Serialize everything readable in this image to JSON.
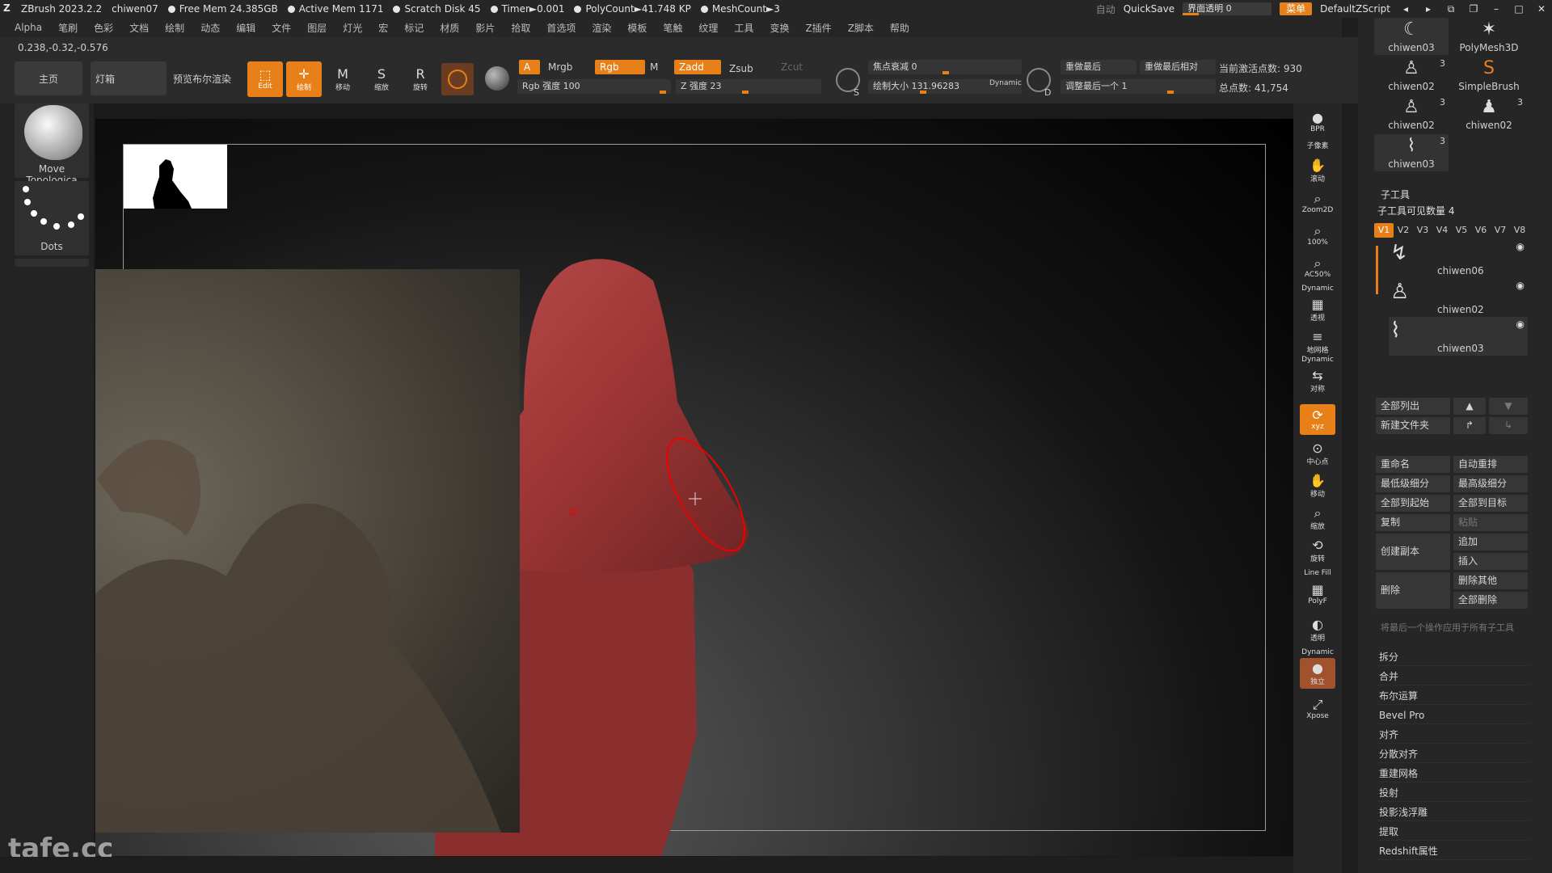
{
  "title_bar": {
    "app": "ZBrush 2023.2.2",
    "project": "chiwen07",
    "free_mem": "Free Mem 24.385GB",
    "active_mem": "Active Mem 1171",
    "scratch_disk": "Scratch Disk 45",
    "timer": "Timer►0.001",
    "poly_count": "PolyCount►41.748 KP",
    "mesh_count": "MeshCount►3",
    "auto": "自动",
    "quicksave": "QuickSave",
    "transparency": "界面透明 0",
    "menu": "菜单",
    "script": "DefaultZScript"
  },
  "menu_items": [
    "Alpha",
    "笔刷",
    "色彩",
    "文档",
    "绘制",
    "动态",
    "编辑",
    "文件",
    "图层",
    "灯光",
    "宏",
    "标记",
    "材质",
    "影片",
    "拾取",
    "首选项",
    "渲染",
    "模板",
    "笔触",
    "纹理",
    "工具",
    "变换",
    "Z插件",
    "Z脚本",
    "帮助"
  ],
  "coords": "0.238,-0.32,-0.576",
  "toolbar": {
    "home": "主页",
    "lightbox": "灯箱",
    "preview_bool": "预览布尔渲染",
    "edit": "Edit",
    "draw": "绘制",
    "move": "移动",
    "scale": "缩放",
    "rotate": "旋转",
    "a": "A",
    "mrgb": "Mrgb",
    "rgb": "Rgb",
    "m": "M",
    "zadd": "Zadd",
    "zsub": "Zsub",
    "zcut": "Zcut",
    "rgb_intensity": "Rgb 强度 100",
    "z_intensity": "Z 强度 23",
    "focal_shift": "焦点衰减 0",
    "draw_size": "绘制大小 131.96283",
    "dynamic": "Dynamic",
    "s_label": "S",
    "d_label": "D",
    "redo_last": "重做最后",
    "redo_last_rel": "重做最后相对",
    "adjust_last": "调整最后一个 1",
    "active_points": "当前激活点数: 930",
    "total_points": "总点数: 41,754"
  },
  "left_shelf": {
    "brush_name": "Move Topologica",
    "stroke_name": "Dots"
  },
  "right_bar": [
    "BPR",
    "子像素",
    "滚动",
    "Zoom2D",
    "100%",
    "AC50%",
    "Dynamic",
    "透视",
    "地网格",
    "Dynamic",
    "对称",
    "xyz",
    "中心点",
    "移动",
    "缩放",
    "旋转",
    "Line Fill",
    "PolyF",
    "透明",
    "Dynamic",
    "独立",
    "Xpose"
  ],
  "tool_thumbs": [
    {
      "name": "chiwen03",
      "count": ""
    },
    {
      "name": "PolyMesh3D",
      "count": ""
    },
    {
      "name": "chiwen02",
      "count": "3"
    },
    {
      "name": "SimpleBrush",
      "count": ""
    },
    {
      "name": "chiwen02",
      "count": "3"
    },
    {
      "name": "chiwen02",
      "count": "3"
    },
    {
      "name": "chiwen03",
      "count": "3"
    }
  ],
  "subtool_panel": {
    "title": "子工具",
    "visible_count": "子工具可见数量 4",
    "versions": [
      "V1",
      "V2",
      "V3",
      "V4",
      "V5",
      "V6",
      "V7",
      "V8"
    ],
    "subtools": [
      "chiwen06",
      "chiwen02",
      "chiwen03"
    ],
    "list_all": "全部列出",
    "new_folder": "新建文件夹",
    "rename": "重命名",
    "auto_reorder": "自动重排",
    "lowest_subdiv": "最低级细分",
    "highest_subdiv": "最高级细分",
    "all_to_start": "全部到起始",
    "all_to_target": "全部到目标",
    "copy": "复制",
    "paste": "粘贴",
    "create_copy": "创建副本",
    "append": "追加",
    "insert": "插入",
    "delete": "删除",
    "delete_other": "删除其他",
    "delete_all": "全部删除",
    "apply_last": "将最后一个操作应用于所有子工具",
    "sections": [
      "拆分",
      "合并",
      "布尔运算",
      "Bevel Pro",
      "对齐",
      "分散对齐",
      "重建网格",
      "投射",
      "投影浅浮雕",
      "提取",
      "Redshift属性"
    ]
  },
  "watermark": "tafe.cc",
  "colors": {
    "accent": "#e8801a",
    "model": "#9c3535",
    "bg": "#262626"
  }
}
